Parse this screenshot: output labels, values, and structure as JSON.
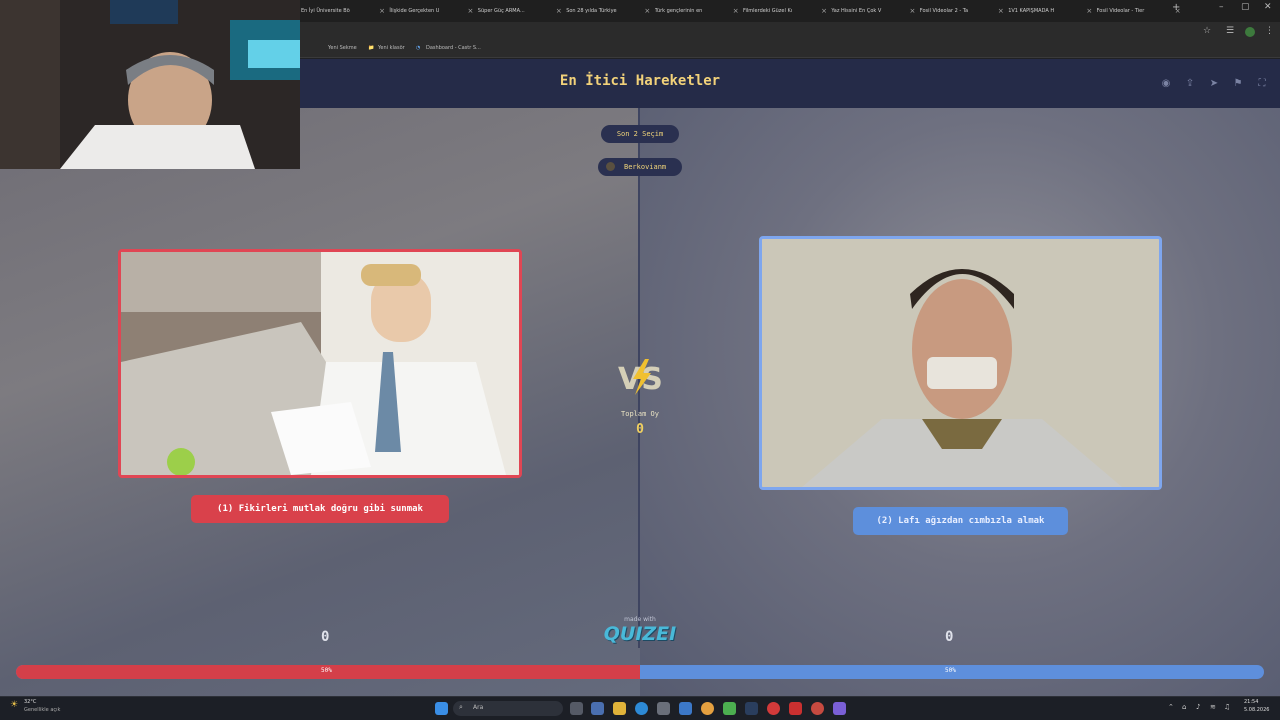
{
  "browser": {
    "tabs": [
      {
        "title": "En İyi Üniversite Bö"
      },
      {
        "title": "İlişkide Gerçekten U"
      },
      {
        "title": "Süper Güç ARMA..."
      },
      {
        "title": "Son 28 yılda Türkiye"
      },
      {
        "title": "Türk gençlerinin en"
      },
      {
        "title": "Filmlerdeki Güzel Kı"
      },
      {
        "title": "Yaz Hissini En Çok V"
      },
      {
        "title": "Fosil Videolar 2 - Ta"
      },
      {
        "title": "1V1 KAPIŞMADA H"
      },
      {
        "title": "Fosil Videolar - Tier"
      }
    ],
    "new_tab": "+",
    "window_controls": {
      "minimize": "–",
      "restore": "▢",
      "close": "✕"
    },
    "bookmarks": [
      {
        "label": "Yeni Sekme"
      },
      {
        "label": "Yeni klasör"
      },
      {
        "label": "Dashboard - Castr S..."
      }
    ]
  },
  "header": {
    "title": "En İtici Hareketler",
    "icons": [
      "eye-icon",
      "share-icon",
      "send-icon",
      "flag-icon",
      "fullscreen-icon"
    ]
  },
  "round": {
    "label": "Son 2 Seçim"
  },
  "user": {
    "name": "Berkovianm"
  },
  "options": [
    {
      "label": "(1) Fikirleri mutlak doğru gibi sunmak",
      "score": "0",
      "percent": "50%",
      "color": "#d9414b"
    },
    {
      "label": "(2) Lafı ağızdan cımbızla almak",
      "score": "0",
      "percent": "50%",
      "color": "#5d8fdc"
    }
  ],
  "vs": {
    "text": "VS"
  },
  "total": {
    "label": "Toplam Oy",
    "value": "0"
  },
  "branding": {
    "made_with": "made with",
    "logo": "QUIZEI"
  },
  "vote_split": {
    "left_fraction": 0.5,
    "right_fraction": 0.5
  },
  "taskbar": {
    "weather_temp": "32°C",
    "weather_desc": "Genellikle açık",
    "search_placeholder": "Ara",
    "time": "21:54",
    "date": "5.08.2026"
  }
}
